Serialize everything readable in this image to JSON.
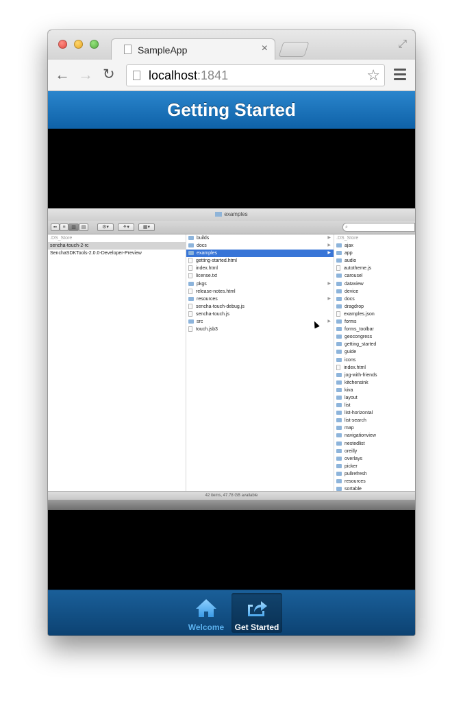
{
  "browser": {
    "tab_title": "SampleApp",
    "tab_close": "×",
    "url_host": "localhost",
    "url_port": ":1841"
  },
  "app": {
    "title": "Getting Started",
    "tabs": [
      {
        "label": "Welcome",
        "icon": "home-icon",
        "active": false
      },
      {
        "label": "Get Started",
        "icon": "share-icon",
        "active": true
      }
    ]
  },
  "finder": {
    "title": "examples",
    "status": "42 items, 47.78 GB available",
    "column1": [
      ".DS_Store",
      "sencha-touch-2-rc",
      "SenchaSDKTools-2.0.0-Developer-Preview"
    ],
    "column2": [
      {
        "name": "builds",
        "kind": "folder"
      },
      {
        "name": "docs",
        "kind": "folder"
      },
      {
        "name": "examples",
        "kind": "folder"
      },
      {
        "name": "getting-started.html",
        "kind": "file"
      },
      {
        "name": "index.html",
        "kind": "file"
      },
      {
        "name": "license.txt",
        "kind": "file"
      },
      {
        "name": "pkgs",
        "kind": "folder"
      },
      {
        "name": "release-notes.html",
        "kind": "file"
      },
      {
        "name": "resources",
        "kind": "folder"
      },
      {
        "name": "sencha-touch-debug.js",
        "kind": "file"
      },
      {
        "name": "sencha-touch.js",
        "kind": "file"
      },
      {
        "name": "src",
        "kind": "folder"
      },
      {
        "name": "touch.jsb3",
        "kind": "file"
      }
    ],
    "column3": [
      ".DS_Store",
      "ajax",
      "app",
      "audio",
      "autotheme.js",
      "carousel",
      "dataview",
      "device",
      "docs",
      "dragdrop",
      "examples.json",
      "forms",
      "forms_toolbar",
      "geocongress",
      "getting_started",
      "guide",
      "icons",
      "index.html",
      "jog-with-friends",
      "kitchensink",
      "kiva",
      "layout",
      "list",
      "list-horizontal",
      "list-search",
      "map",
      "navigationview",
      "nestedlist",
      "oreilly",
      "overlays",
      "picker",
      "pullrefresh",
      "resources",
      "sortable"
    ]
  },
  "colors": {
    "titlebar": "#1a73bb",
    "tabbar": "#0f4c80",
    "active_label": "#ffffff",
    "inactive_label": "#5bb1ee"
  }
}
